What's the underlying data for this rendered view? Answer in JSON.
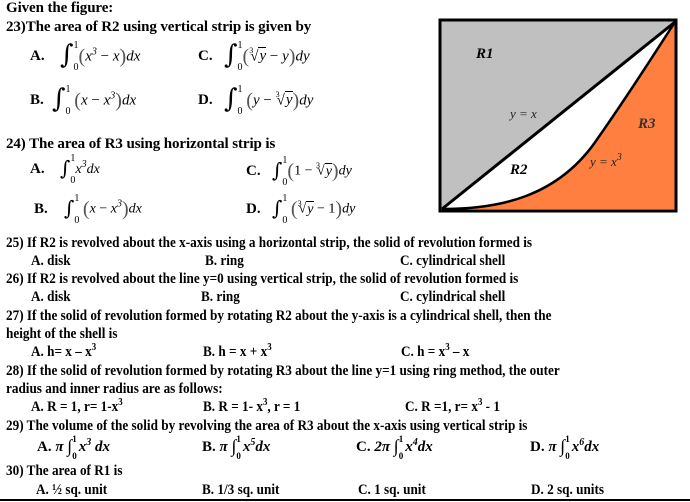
{
  "heading": "Given the figure:",
  "questions": {
    "q23": {
      "prompt": "23)The area of R2 using vertical strip is given by",
      "options": [
        {
          "label": "A.",
          "lower": "0",
          "upper": "1",
          "integrand_a": "x",
          "exp_a": "3",
          "op": " − ",
          "integrand_b": "x",
          "differential": "dx",
          "text": "∫₀¹ (x³ − x) dx"
        },
        {
          "label": "B.",
          "lower": "0",
          "upper": "1",
          "integrand_a": "x",
          "op": " − ",
          "integrand_b": "x",
          "exp_b": "3",
          "differential": "dx",
          "text": "∫₀¹ (x − x³) dx"
        },
        {
          "label": "C.",
          "lower": "0",
          "upper": "1",
          "root_index": "3",
          "radicand": "y",
          "op": " − ",
          "integrand_b": "y",
          "differential": "dy",
          "text": "∫₀¹ (∛y − y) dy"
        },
        {
          "label": "D.",
          "lower": "0",
          "upper": "1",
          "integrand_a": "y",
          "op": " − ",
          "root_index": "3",
          "radicand": "y",
          "differential": "dy",
          "text": "∫₀¹ (y − ∛y) dy"
        }
      ]
    },
    "q24": {
      "prompt": "24) The area of R3 using horizontal strip is",
      "options": [
        {
          "label": "A.",
          "lower": "0",
          "upper": "1",
          "integrand_a": "x",
          "exp_a": "3",
          "differential": "dx",
          "text": "∫₀¹ x³ dx"
        },
        {
          "label": "B.",
          "lower": "0",
          "upper": "1",
          "integrand_a": "x",
          "op": " − ",
          "integrand_b": "x",
          "exp_b": "3",
          "differential": "dx",
          "text": "∫₀¹ (x − x³) dx"
        },
        {
          "label": "C.",
          "lower": "0",
          "upper": "1",
          "integrand_a": "1",
          "op": " − ",
          "root_index": "3",
          "radicand": "y",
          "differential": "dy",
          "text": "∫₀¹ (1 − ∛y) dy"
        },
        {
          "label": "D.",
          "lower": "0",
          "upper": "1",
          "root_index": "3",
          "radicand": "y",
          "op": " − ",
          "integrand_b": "1",
          "differential": "dy",
          "text": "∫₀¹ (∛y − 1) dy"
        }
      ]
    },
    "q25": {
      "prompt": "25) If R2 is revolved about the x-axis using a horizontal strip, the solid of revolution formed is",
      "options": [
        "A. disk",
        "B. ring",
        "C. cylindrical shell"
      ]
    },
    "q26": {
      "prompt": "26) If R2 is revolved about the line y=0 using vertical strip, the solid of revolution formed is",
      "options": [
        "A. disk",
        "B. ring",
        "C. cylindrical shell"
      ]
    },
    "q27": {
      "prompt_line1": "27) If the solid of revolution formed by rotating R2 about the y-axis is a cylindrical shell, then the",
      "prompt_line2": "height of the shell is",
      "options": [
        {
          "pre": "A.  h= x – x",
          "sup": "3",
          "post": ""
        },
        {
          "pre": "B.  h = x + x",
          "sup": "3",
          "post": ""
        },
        {
          "pre": "C. h = x",
          "sup": "3",
          "post": " – x"
        }
      ]
    },
    "q28": {
      "prompt_line1": "28) If the solid of revolution formed by rotating R3 about the line y=1 using ring method, the outer",
      "prompt_line2": "radius and inner radius are as follows:",
      "options": [
        {
          "pre": "A. R = 1, r= 1-x",
          "sup": "3",
          "post": ""
        },
        {
          "pre": "B. R = 1- x",
          "sup": "3",
          "post": ", r = 1"
        },
        {
          "pre": "C. R =1, r= x",
          "sup": "3",
          "post": " - 1"
        }
      ]
    },
    "q29": {
      "prompt": "29) The volume of the solid by revolving the area of R3 about the x-axis using vertical strip is",
      "options": [
        {
          "label": "A.",
          "coef": "π",
          "lower": "0",
          "upper": "1",
          "base": "x",
          "exp": "3",
          "differential": "dx"
        },
        {
          "label": "B.",
          "coef": "π",
          "lower": "0",
          "upper": "1",
          "base": "x",
          "exp": "5",
          "differential": "dx"
        },
        {
          "label": "C.",
          "coef": "2π",
          "lower": "0",
          "upper": "1",
          "base": "x",
          "exp": "4",
          "differential": "dx"
        },
        {
          "label": "D.",
          "coef": "π",
          "lower": "0",
          "upper": "1",
          "base": "x",
          "exp": "6",
          "differential": "dx"
        }
      ]
    },
    "q30": {
      "prompt": "30) The area of R1 is",
      "options": [
        "A. ½ sq. unit",
        "B. 1/3 sq. unit",
        "C. 1  sq. unit",
        "D. 2 sq. units"
      ]
    }
  },
  "figure": {
    "regions": {
      "r1": "R1",
      "r2": "R2",
      "r3": "R3"
    },
    "curves": {
      "line": "y = x",
      "cubic_base": "y = x",
      "cubic_exp": "3"
    },
    "colors": {
      "r1": "#c0c0c0",
      "r2": "#ffffff",
      "r3": "#ff7f40",
      "stroke": "#000000"
    }
  }
}
